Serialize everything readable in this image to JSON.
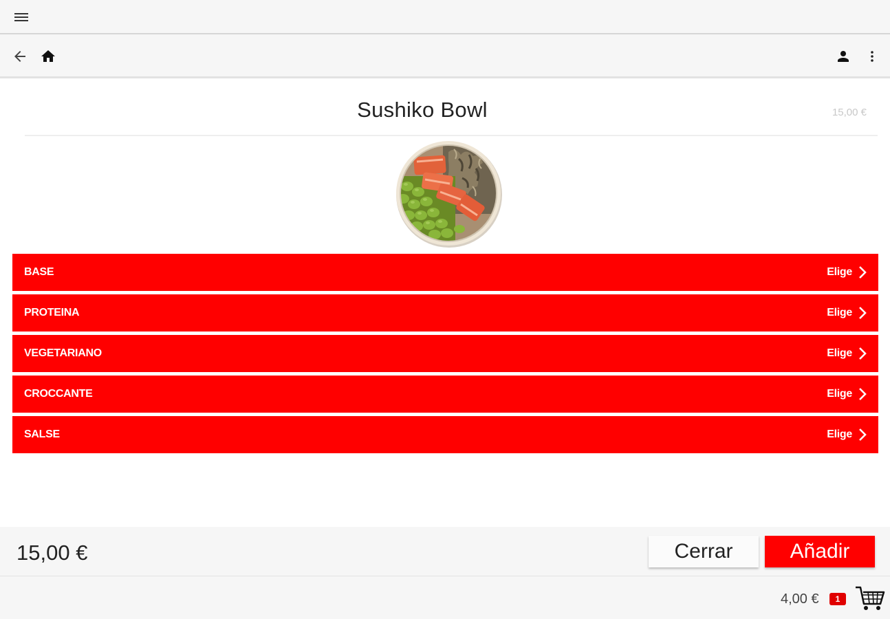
{
  "colors": {
    "accent": "#ff0000",
    "bar_background": "#f6f6f6",
    "badge": "#e00000"
  },
  "icons": {
    "menu": "hamburger-menu-icon",
    "back": "arrow-left-icon",
    "home": "home-icon",
    "user": "user-icon",
    "more": "more-vertical-icon",
    "chevron": "chevron-right-icon",
    "cart": "shopping-cart-icon"
  },
  "product": {
    "title": "Sushiko Bowl",
    "price": "15,00 €",
    "image": "poke-bowl-image"
  },
  "options": [
    {
      "label": "BASE",
      "action": "Elige"
    },
    {
      "label": "PROTEINA",
      "action": "Elige"
    },
    {
      "label": "VEGETARIANO",
      "action": "Elige"
    },
    {
      "label": "CROCCANTE",
      "action": "Elige"
    },
    {
      "label": "SALSE",
      "action": "Elige"
    }
  ],
  "footer": {
    "total": "15,00 €",
    "close_label": "Cerrar",
    "add_label": "Añadir"
  },
  "cart": {
    "total": "4,00 €",
    "count": "1"
  }
}
